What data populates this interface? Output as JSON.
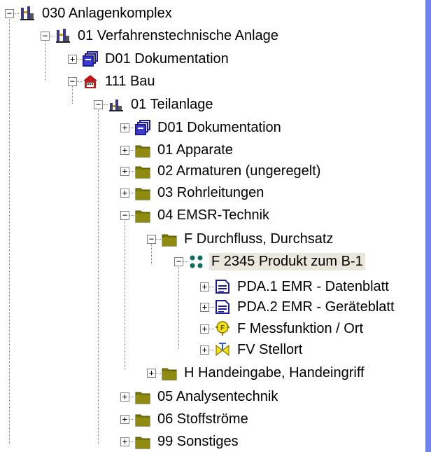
{
  "tree": {
    "nodes": [
      {
        "label": "030  Anlagenkomplex",
        "icon": "plant-complex-icon",
        "expanded": true,
        "depth": 0
      },
      {
        "label": "01  Verfahrenstechnische Anlage",
        "icon": "plant-icon",
        "expanded": true,
        "depth": 1
      },
      {
        "label": "D01  Dokumentation",
        "icon": "documentation-stack-icon",
        "expanded": false,
        "depth": 2
      },
      {
        "label": "111  Bau",
        "icon": "building-icon",
        "expanded": true,
        "depth": 2
      },
      {
        "label": "01  Teilanlage",
        "icon": "sub-plant-icon",
        "expanded": true,
        "depth": 3
      },
      {
        "label": "D01  Dokumentation",
        "icon": "documentation-stack-icon",
        "expanded": false,
        "depth": 4
      },
      {
        "label": "01  Apparate",
        "icon": "folder-icon",
        "expanded": false,
        "depth": 4
      },
      {
        "label": "02  Armaturen (ungeregelt)",
        "icon": "folder-icon",
        "expanded": false,
        "depth": 4
      },
      {
        "label": "03  Rohrleitungen",
        "icon": "folder-icon",
        "expanded": false,
        "depth": 4
      },
      {
        "label": "04  EMSR-Technik",
        "icon": "folder-icon",
        "expanded": true,
        "depth": 4
      },
      {
        "label": "F  Durchfluss, Durchsatz",
        "icon": "folder-icon",
        "expanded": true,
        "depth": 5
      },
      {
        "label": "F 2345  Produkt zum B-1",
        "icon": "measurement-point-icon",
        "expanded": true,
        "depth": 6,
        "selected": true
      },
      {
        "label": "PDA.1  EMR - Datenblatt",
        "icon": "datasheet-icon",
        "expanded": false,
        "depth": 7
      },
      {
        "label": "PDA.2  EMR - Geräteblatt",
        "icon": "datasheet-icon",
        "expanded": false,
        "depth": 7
      },
      {
        "label": "F  Messfunktion / Ort",
        "icon": "measuring-function-icon",
        "expanded": false,
        "depth": 7
      },
      {
        "label": "FV  Stellort",
        "icon": "valve-icon",
        "expanded": false,
        "depth": 7
      },
      {
        "label": "H  Handeingabe, Handeingriff",
        "icon": "folder-icon",
        "expanded": false,
        "depth": 5
      },
      {
        "label": "05  Analysentechnik",
        "icon": "folder-icon",
        "expanded": false,
        "depth": 4
      },
      {
        "label": "06  Stoffströme",
        "icon": "folder-icon",
        "expanded": false,
        "depth": 4
      },
      {
        "label": "99  Sonstiges",
        "icon": "folder-icon",
        "expanded": false,
        "depth": 4
      }
    ]
  },
  "colors": {
    "background_gradient": [
      "#2a32d8",
      "#6d86f0"
    ],
    "folder": "#7f7a00",
    "selection": "#ebe7dc",
    "connector": "#808080"
  }
}
